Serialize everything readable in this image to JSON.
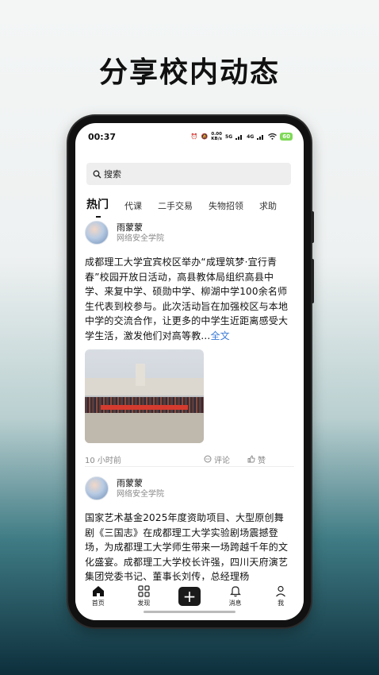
{
  "headline": "分享校内动态",
  "status_bar": {
    "time": "00:37",
    "net_speed_value": "0.00",
    "net_speed_unit": "KB/s",
    "network": "5G",
    "network2": "4G",
    "battery": "60"
  },
  "search": {
    "label": "搜索"
  },
  "tabs": [
    "热门",
    "代课",
    "二手交易",
    "失物招领",
    "求助"
  ],
  "posts": [
    {
      "author": "雨蒙蒙",
      "org": "网络安全学院",
      "text": "成都理工大学宜宾校区举办“成理筑梦·宜行青春”校园开放日活动，高县教体局组织高县中学、来复中学、硕勋中学、柳湖中学100余名师生代表到校参与。此次活动旨在加强校区与本地中学的交流合作，让更多的中学生近距离感受大学生活，激发他们对高等教...",
      "more": "全文",
      "time": "10 小时前",
      "comment": "评论",
      "like": "赞"
    },
    {
      "author": "雨蒙蒙",
      "org": "网络安全学院",
      "text": "国家艺术基金2025年度资助项目、大型原创舞剧《三国志》在成都理工大学实验剧场震撼登场，为成都理工大学师生带来一场跨越千年的文化盛宴。成都理工大学校长许强，四川天府演艺集团党委书记、董事长刘传，总经理杨"
    }
  ],
  "bottom_nav": [
    {
      "label": "首页",
      "icon": "home-icon"
    },
    {
      "label": "发现",
      "icon": "grid-icon"
    },
    {
      "label": "",
      "icon": "plus-icon"
    },
    {
      "label": "消息",
      "icon": "bell-icon"
    },
    {
      "label": "我",
      "icon": "user-icon"
    }
  ],
  "colors": {
    "accent_link": "#3a7bd5",
    "battery": "#7ed957"
  }
}
